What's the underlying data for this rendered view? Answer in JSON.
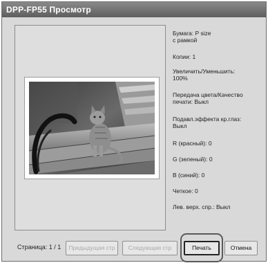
{
  "window": {
    "title": "DPP-FP55 Просмотр"
  },
  "info": {
    "paper": "Бумага: P size\n           с рамкой",
    "copies": "Копии: 1",
    "zoom": "Увеличить/Уменьшить:\n100%",
    "color_quality": "Передача цвета/Качество\nпечати: Выкл",
    "red_eye": "Подавл.эффекта кр.глаз:\nВыкл",
    "r": "R (красный): 0",
    "g": "G (зеленый): 0",
    "b": "B (синий): 0",
    "sharpness": "Четкое: 0",
    "upper_left": "Лев. верх. спр.: Выкл"
  },
  "footer": {
    "page_label": "Страница: 1 / 1",
    "prev_label": "Предыдущая стр",
    "next_label": "Следующая стр",
    "print_label": "Печать",
    "cancel_label": "Отмена"
  }
}
